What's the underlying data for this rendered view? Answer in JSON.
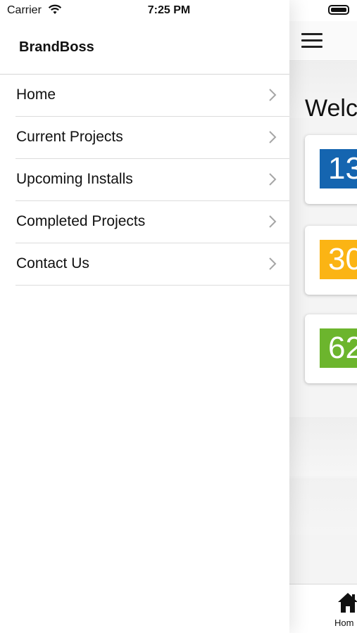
{
  "status_bar": {
    "carrier": "Carrier",
    "time": "7:25 PM"
  },
  "drawer": {
    "title": "BrandBoss",
    "menu": [
      {
        "label": "Home"
      },
      {
        "label": "Current Projects"
      },
      {
        "label": "Upcoming Installs"
      },
      {
        "label": "Completed Projects"
      },
      {
        "label": "Contact Us"
      }
    ]
  },
  "main": {
    "welcome_text": "Welc",
    "stats": [
      {
        "value": "13",
        "color": "#1565b0"
      },
      {
        "value": "30",
        "color": "#fbb414"
      },
      {
        "value": "62",
        "color": "#6cb52d"
      }
    ],
    "bottom_tab": {
      "label": "Hom",
      "icon": "home-icon"
    }
  }
}
